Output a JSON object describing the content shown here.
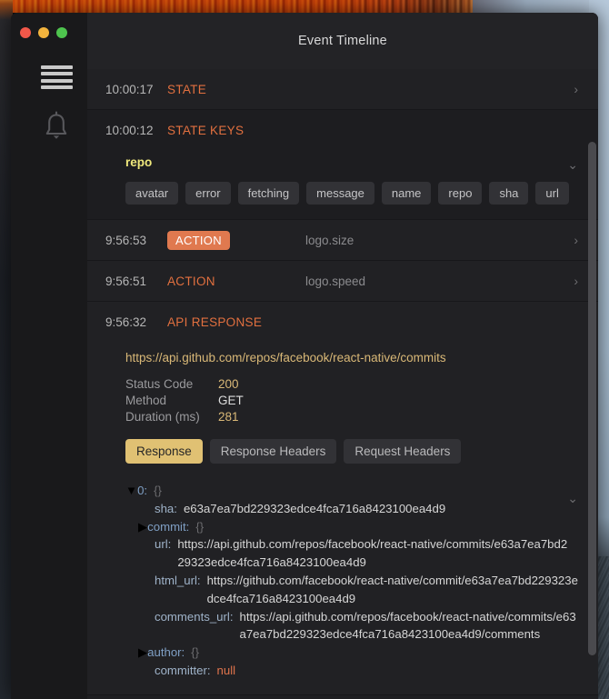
{
  "window": {
    "title": "Event Timeline",
    "traffic_lights": [
      "close",
      "minimize",
      "zoom"
    ]
  },
  "sidebar": {
    "items": [
      {
        "icon": "hamburger-menu-icon",
        "label": "Menu"
      },
      {
        "icon": "bell-icon",
        "label": "Notifications"
      }
    ]
  },
  "events": [
    {
      "time": "10:00:17",
      "type": "STATE",
      "label": "",
      "expanded": false,
      "chevron": "›",
      "badge": false
    },
    {
      "time": "10:00:12",
      "type": "STATE KEYS",
      "label": "",
      "expanded": true,
      "chevron": "⌄",
      "badge": false,
      "keys_title": "repo",
      "chips": [
        "avatar",
        "error",
        "fetching",
        "message",
        "name",
        "repo",
        "sha",
        "url"
      ]
    },
    {
      "time": "9:56:53",
      "type": "ACTION",
      "label": "logo.size",
      "expanded": false,
      "chevron": "›",
      "badge": true
    },
    {
      "time": "9:56:51",
      "type": "ACTION",
      "label": "logo.speed",
      "expanded": false,
      "chevron": "›",
      "badge": false
    },
    {
      "time": "9:56:32",
      "type": "API RESPONSE",
      "label": "",
      "expanded": true,
      "chevron": "⌄",
      "badge": false,
      "url": "https://api.github.com/repos/facebook/react-native/commits",
      "meta": [
        {
          "key": "Status Code",
          "value": "200",
          "accent": true
        },
        {
          "key": "Method",
          "value": "GET",
          "accent": false
        },
        {
          "key": "Duration (ms)",
          "value": "281",
          "accent": true
        }
      ],
      "tabs": [
        {
          "label": "Response",
          "active": true
        },
        {
          "label": "Response Headers",
          "active": false
        },
        {
          "label": "Request Headers",
          "active": false
        }
      ],
      "tree": [
        {
          "arrow": "▼",
          "key": "0:",
          "value": "{}",
          "kind": "obj",
          "indent": 0
        },
        {
          "arrow": "",
          "key": "sha:",
          "value": "e63a7ea7bd229323edce4fca716a8423100ea4d9",
          "kind": "str",
          "indent": 1
        },
        {
          "arrow": "▶",
          "key": "commit:",
          "value": "{}",
          "kind": "obj",
          "indent": 1
        },
        {
          "arrow": "",
          "key": "url:",
          "value": "https://api.github.com/repos/facebook/react-native/commits/e63a7ea7bd229323edce4fca716a8423100ea4d9",
          "kind": "str",
          "indent": 1
        },
        {
          "arrow": "",
          "key": "html_url:",
          "value": "https://github.com/facebook/react-native/commit/e63a7ea7bd229323edce4fca716a8423100ea4d9",
          "kind": "str",
          "indent": 1
        },
        {
          "arrow": "",
          "key": "comments_url:",
          "value": "https://api.github.com/repos/facebook/react-native/commits/e63a7ea7bd229323edce4fca716a8423100ea4d9/comments",
          "kind": "str",
          "indent": 1
        },
        {
          "arrow": "▶",
          "key": "author:",
          "value": "{}",
          "kind": "obj",
          "indent": 1
        },
        {
          "arrow": "",
          "key": "committer:",
          "value": "null",
          "kind": "null",
          "indent": 1
        }
      ]
    }
  ],
  "colors": {
    "accent_orange": "#e2703f",
    "badge_orange": "#e0794f",
    "gold": "#d9b877",
    "tab_active": "#e0c173",
    "keys_yellow": "#efe87c",
    "json_key": "#7f9fc4",
    "panel_bg": "#1f1f22",
    "rail_bg": "#19191b"
  }
}
